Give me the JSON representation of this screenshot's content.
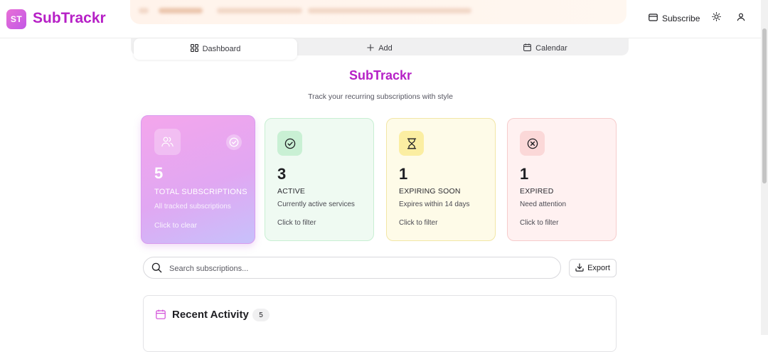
{
  "header": {
    "logo_badge": "ST",
    "logo_text": "SubTrackr",
    "subscribe_label": "Subscribe",
    "theme_icon": "sun-icon",
    "profile_icon": "user-icon"
  },
  "tabs": [
    {
      "label": "Dashboard",
      "icon": "grid-icon",
      "active": true
    },
    {
      "label": "Add",
      "icon": "plus-icon",
      "active": false
    },
    {
      "label": "Calendar",
      "icon": "calendar-icon",
      "active": false
    }
  ],
  "hero": {
    "title": "SubTrackr",
    "subtitle": "Track your recurring subscriptions with style"
  },
  "cards": [
    {
      "value": "5",
      "label": "TOTAL SUBSCRIPTIONS",
      "description": "All tracked subscriptions",
      "hint": "Click to clear",
      "icon": "users-icon",
      "accent": "#e6a1ee"
    },
    {
      "value": "3",
      "label": "ACTIVE",
      "description": "Currently active services",
      "hint": "Click to filter",
      "icon": "check-circle-icon",
      "accent": "#c9f0d4"
    },
    {
      "value": "1",
      "label": "EXPIRING SOON",
      "description": "Expires within 14 days",
      "hint": "Click to filter",
      "icon": "hourglass-icon",
      "accent": "#fbeea2"
    },
    {
      "value": "1",
      "label": "EXPIRED",
      "description": "Need attention",
      "hint": "Click to filter",
      "icon": "x-circle-icon",
      "accent": "#fbd8d8"
    }
  ],
  "search": {
    "placeholder": "Search subscriptions...",
    "value": ""
  },
  "export_label": "Export",
  "activity": {
    "title": "Recent Activity",
    "count": "5"
  },
  "colors": {
    "brand": "#b620c6",
    "brand_gradient_start": "#e870d6",
    "brand_gradient_end": "#c257e6"
  }
}
